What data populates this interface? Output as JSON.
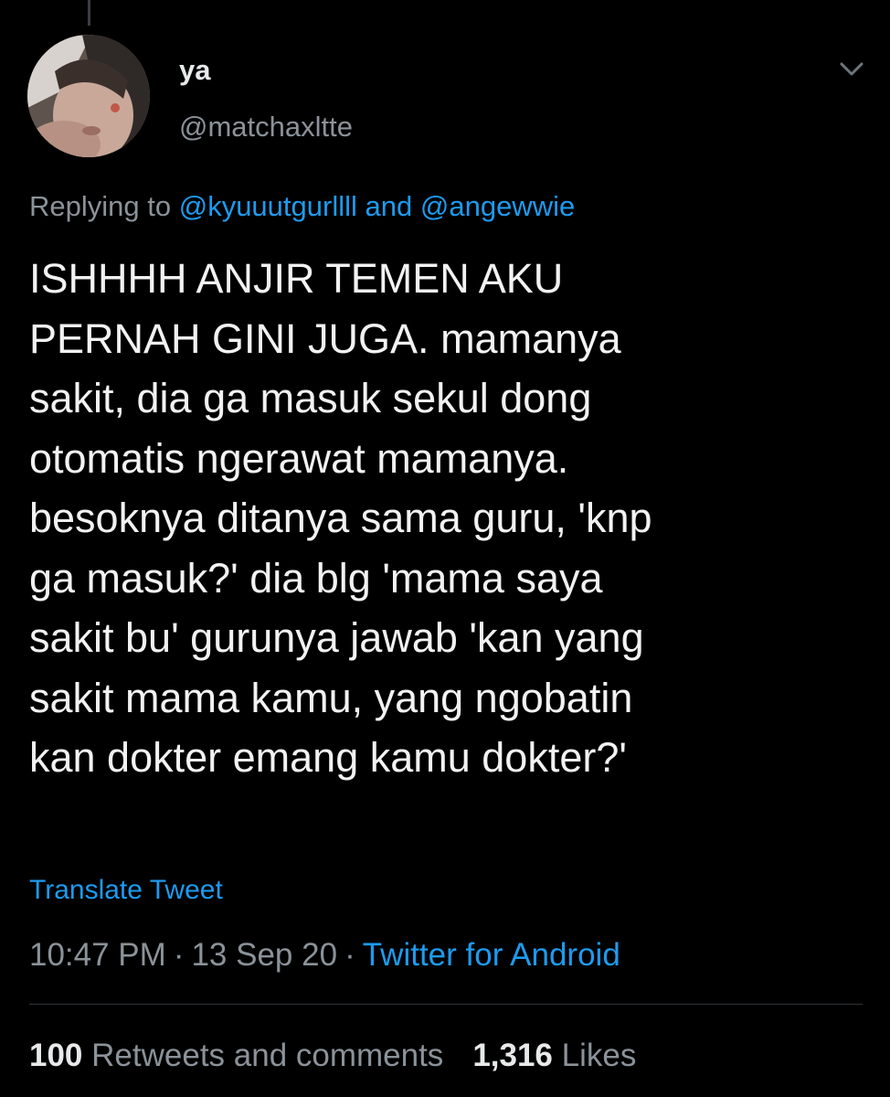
{
  "tweet": {
    "author": {
      "display_name": "ya",
      "handle": "@matchaxltte"
    },
    "replying_to": {
      "prefix": "Replying to",
      "user1": "@kyuuutgurllll",
      "conjunction": "and",
      "user2": "@angewwie"
    },
    "text": "ISHHHH ANJIR TEMEN AKU\nPERNAH GINI JUGA. mamanya\nsakit, dia ga masuk sekul dong\notomatis ngerawat mamanya.\nbesoknya ditanya sama guru, 'knp\nga masuk?' dia blg 'mama saya\nsakit bu' gurunya jawab 'kan yang\nsakit mama kamu, yang ngobatin\nkan dokter emang kamu dokter?'",
    "translate_label": "Translate Tweet",
    "time": "10:47 PM",
    "date": "13 Sep 20",
    "source": "Twitter for Android",
    "separator": "·",
    "stats": {
      "retweets_count": "100",
      "retweets_label": "Retweets and comments",
      "likes_count": "1,316",
      "likes_label": "Likes"
    }
  },
  "icons": {
    "more": "chevron-down-icon"
  },
  "colors": {
    "background": "#000000",
    "text": "#e7e9ea",
    "secondary": "#8b9299",
    "link": "#1d9bf0"
  }
}
